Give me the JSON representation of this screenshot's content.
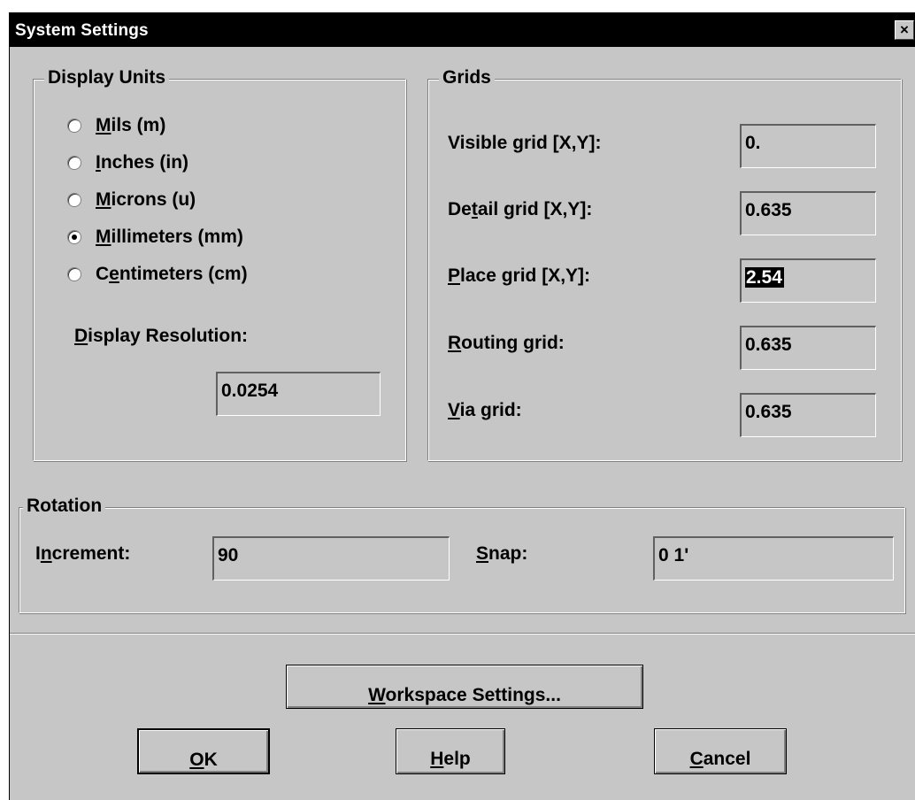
{
  "window": {
    "title": "System Settings",
    "close_glyph": "×"
  },
  "display_units": {
    "legend": "Display Units",
    "options": [
      {
        "pre": "",
        "key": "M",
        "post": "ils (m)",
        "checked": false
      },
      {
        "pre": "",
        "key": "I",
        "post": "nches (in)",
        "checked": false
      },
      {
        "pre": "",
        "key": "M",
        "post": "icrons (u)",
        "checked": false
      },
      {
        "pre": "",
        "key": "M",
        "post": "illimeters (mm)",
        "checked": true
      },
      {
        "pre": "C",
        "key": "e",
        "post": "ntimeters (cm)",
        "checked": false
      }
    ],
    "resolution": {
      "pre": "",
      "key": "D",
      "post": "isplay Resolution:",
      "value": "0.0254"
    }
  },
  "grids": {
    "legend": "Grids",
    "visible": {
      "pre": "Visible ",
      "key": "g",
      "post": "rid [X,Y]:",
      "value": "0."
    },
    "detail": {
      "pre": "De",
      "key": "t",
      "post": "ail grid [X,Y]:",
      "value": "0.635"
    },
    "place": {
      "pre": "",
      "key": "P",
      "post": "lace grid [X,Y]:",
      "value": "2.54"
    },
    "routing": {
      "pre": "",
      "key": "R",
      "post": "outing grid:",
      "value": "0.635"
    },
    "via": {
      "pre": "",
      "key": "V",
      "post": "ia grid:",
      "value": "0.635"
    }
  },
  "rotation": {
    "legend": "Rotation",
    "increment": {
      "pre": "I",
      "key": "n",
      "post": "crement:",
      "value": "90"
    },
    "snap": {
      "pre": "",
      "key": "S",
      "post": "nap:",
      "value": "0 1'"
    }
  },
  "buttons": {
    "workspace": {
      "pre": "",
      "key": "W",
      "post": "orkspace Settings..."
    },
    "ok": {
      "pre": "",
      "key": "O",
      "post": "K"
    },
    "help": {
      "pre": "",
      "key": "H",
      "post": "elp"
    },
    "cancel": {
      "pre": "",
      "key": "C",
      "post": "ancel"
    }
  }
}
